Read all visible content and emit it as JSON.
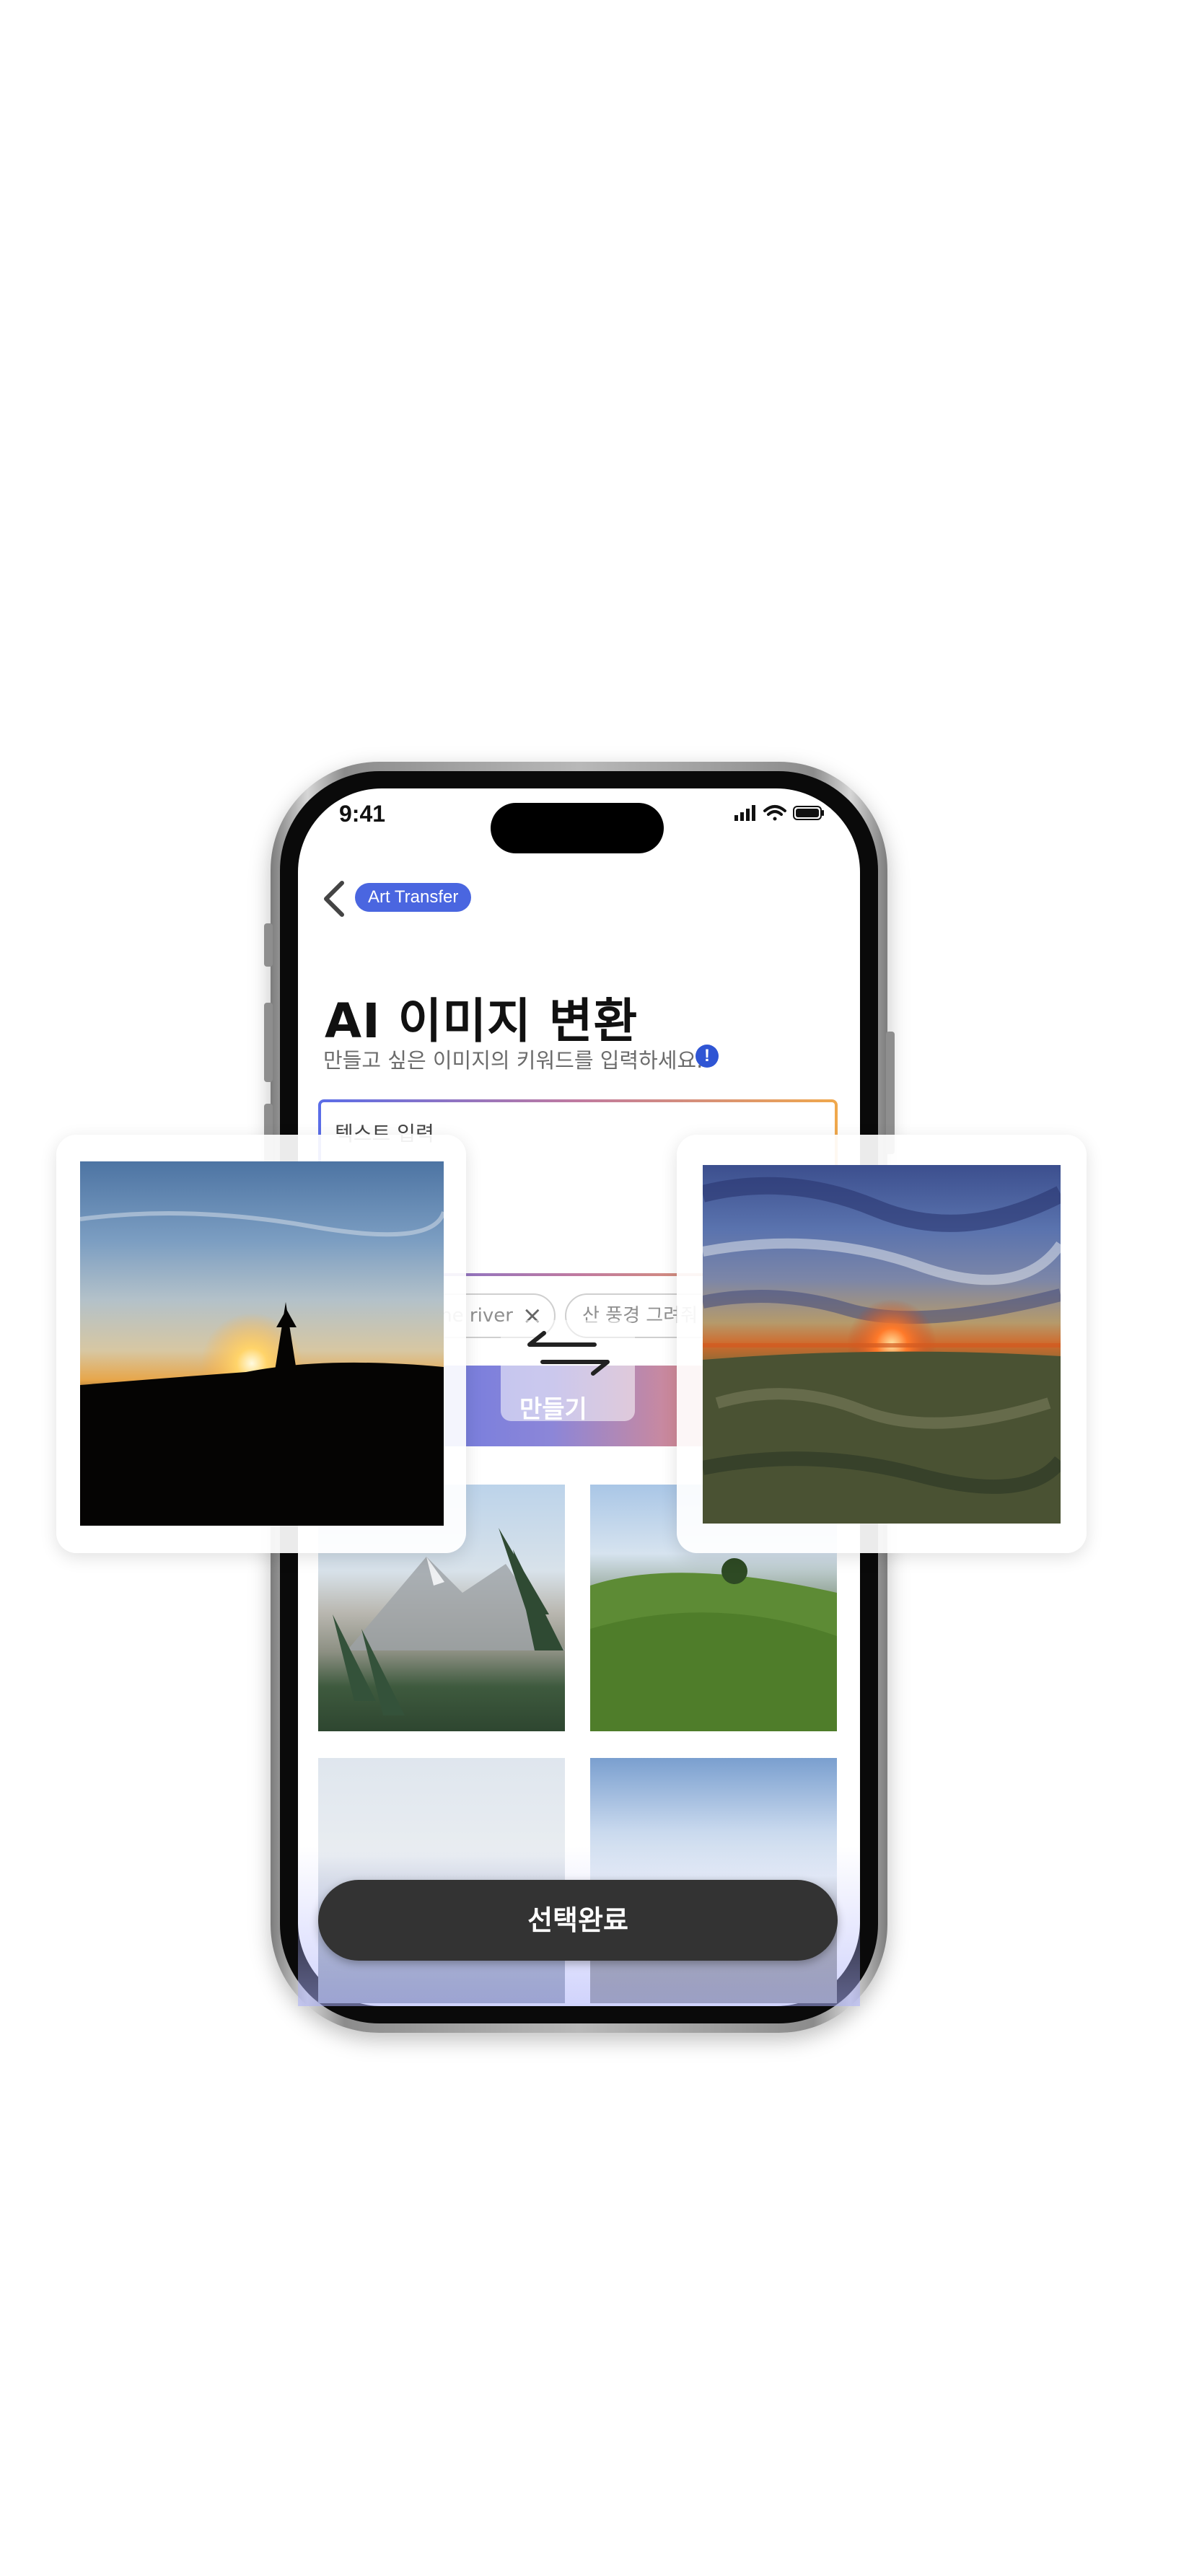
{
  "status_bar": {
    "time": "9:41"
  },
  "header": {
    "badge": "Art Transfer"
  },
  "main": {
    "title": "AI 이미지 변환",
    "subtitle": "만들고 싶은 이미지의 키워드를 입력하세요.",
    "info_icon": "!",
    "text_input_placeholder": "텍스트 입력",
    "chips": [
      {
        "label": "the river"
      },
      {
        "label": "산 풍경 그려줘"
      }
    ],
    "make_button": "만들기",
    "done_button": "선택완료"
  },
  "colors": {
    "accent": "#4a66e0",
    "done_button": "#333333",
    "gradient_start": "#5c73e6",
    "gradient_end": "#e47b7b"
  },
  "icons": [
    "back-chevron-icon",
    "signal-icon",
    "wifi-icon",
    "battery-icon",
    "info-icon",
    "swap-arrows-icon",
    "close-icon"
  ]
}
